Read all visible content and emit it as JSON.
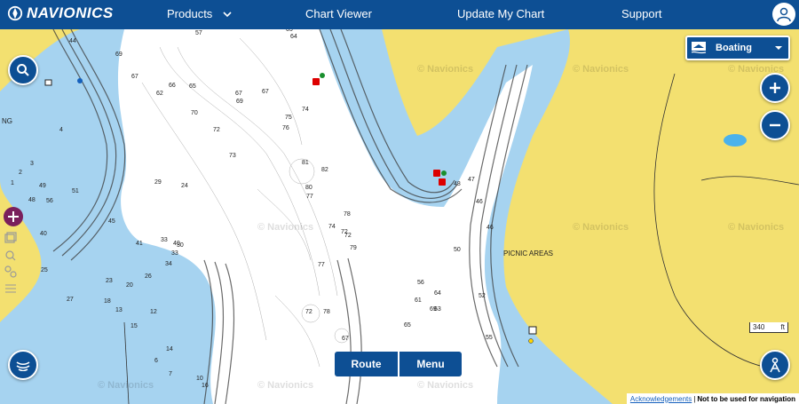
{
  "nav": {
    "brand": "NAVIONICS",
    "items": [
      {
        "label": "Products",
        "has_dropdown": true
      },
      {
        "label": "Chart Viewer"
      },
      {
        "label": "Update My Chart"
      },
      {
        "label": "Support"
      }
    ]
  },
  "mode_selector": {
    "value": "Boating"
  },
  "map": {
    "place_labels": [
      "PICNIC AREAS",
      "NG"
    ],
    "watermark": "Navionics",
    "depth_soundings": [
      "44",
      "57",
      "65",
      "64",
      "69",
      "67",
      "66",
      "65",
      "62",
      "70",
      "67",
      "67",
      "69",
      "72",
      "73",
      "74",
      "76",
      "75",
      "81",
      "82",
      "80",
      "77",
      "74",
      "72",
      "72",
      "79",
      "78",
      "77",
      "72",
      "78",
      "67",
      "65",
      "69",
      "64",
      "61",
      "63",
      "52",
      "56",
      "55",
      "50",
      "47",
      "46",
      "48",
      "46",
      "40",
      "33",
      "34",
      "26",
      "23",
      "25",
      "27",
      "20",
      "13",
      "18",
      "12",
      "15",
      "49",
      "51",
      "56",
      "48",
      "45",
      "41",
      "40",
      "33",
      "30",
      "29",
      "24",
      "14",
      "10",
      "16",
      "7",
      "6",
      "4",
      "3",
      "2",
      "1"
    ]
  },
  "controls": {
    "route_label": "Route",
    "menu_label": "Menu",
    "scale_label": "340",
    "scale_unit": "ft"
  },
  "footer": {
    "ack_label": "Acknowledgements",
    "separator": "|",
    "notice": "Not to be used for navigation"
  },
  "colors": {
    "nav_bg": "#0d4f94",
    "land": "#f3e070",
    "shallow": "#a6d3f0",
    "deep": "#ffffff"
  }
}
